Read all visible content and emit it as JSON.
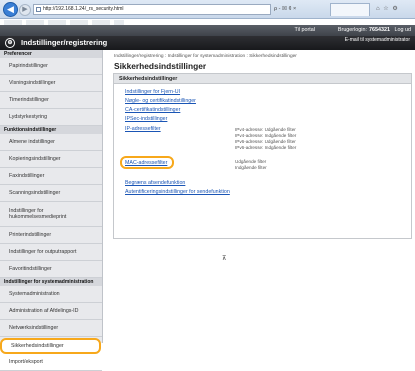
{
  "browser": {
    "url": "http://192.168.1.24/_rs_security.html",
    "addr_controls": "ρ - ☒ ¢ ×",
    "tab_controls": "⌂ ☆ ⚙"
  },
  "topbar": {
    "portal": "Til portal",
    "user_label": "Brugerlogin:",
    "user_id": "7654321",
    "logout": "Log ud"
  },
  "header": {
    "logo": "⊕",
    "title": "Indstillinger/registrering",
    "email": "E-mail til systemadministrator"
  },
  "sidebar": [
    {
      "type": "section",
      "label": "Preferencer"
    },
    {
      "type": "item",
      "label": "Papirindstillinger"
    },
    {
      "type": "item",
      "label": "Visningsindstillinger"
    },
    {
      "type": "item",
      "label": "Timerindstillinger"
    },
    {
      "type": "item",
      "label": "Lydstyrkestyring"
    },
    {
      "type": "section",
      "label": "Funktionsindstillinger"
    },
    {
      "type": "item",
      "label": "Almene indstillinger"
    },
    {
      "type": "item",
      "label": "Kopieringsindstillinger"
    },
    {
      "type": "item",
      "label": "Faxindstillinger"
    },
    {
      "type": "item",
      "label": "Scanningsindstillinger"
    },
    {
      "type": "item2",
      "label": "Indstillinger for hukommelsesmedieprint"
    },
    {
      "type": "item",
      "label": "Printerindstillinger"
    },
    {
      "type": "item",
      "label": "Indstillinger for outputrapport"
    },
    {
      "type": "item",
      "label": "Favoritindstillinger"
    },
    {
      "type": "section",
      "label": "Indstillinger for systemadministration"
    },
    {
      "type": "item",
      "label": "Systemadministration"
    },
    {
      "type": "item",
      "label": "Administration af Afdelings-ID"
    },
    {
      "type": "item",
      "label": "Netværksindstillinger"
    },
    {
      "type": "sel",
      "label": "Sikkerhedsindstillinger"
    },
    {
      "type": "item",
      "label": "Import/eksport"
    }
  ],
  "content": {
    "breadcrumb": "Indstillinger/registrering : Indstillinger for systemadministration : Sikkerhedsindstillinger",
    "title": "Sikkerhedsindstillinger",
    "panel_title": "Sikkerhedsindstillinger",
    "links": {
      "remote_ui": "Indstillinger for Fjern-UI",
      "keys": "Nøgle- og certifikatindstillinger",
      "ca": "CA-certifikatindstillinger",
      "ipsec": "IPSec-indstillinger",
      "ip_filter": "IP-adressefilter",
      "mac_filter": "MAC-adressefilter",
      "send_restrict": "Begræns afsendefunktion",
      "auth": "Autentificeringsindstillinger for sendefunktion"
    },
    "ip_status": [
      "IPv4-adresse: Udgående filter",
      "IPv4-adresse: Indgående filter",
      "IPv6-adresse: Udgående filter",
      "IPv6-adresse: Indgående filter"
    ],
    "mac_status": [
      "Udgående filter",
      "Indgående filter"
    ],
    "to_top": "⊼"
  }
}
